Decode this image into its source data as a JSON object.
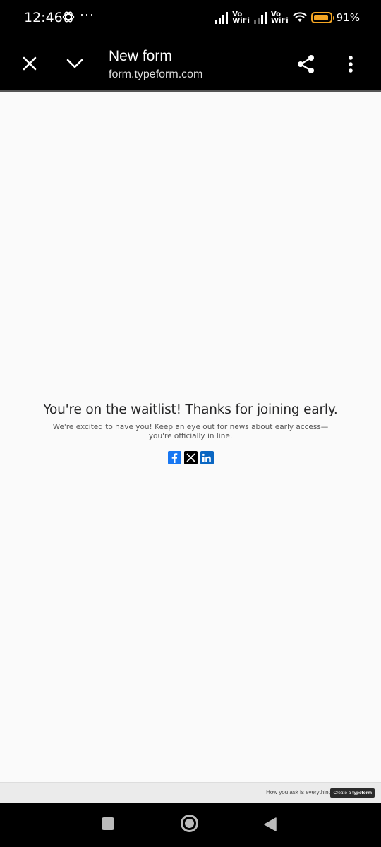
{
  "status_bar": {
    "time": "12:46",
    "dots": "···",
    "vowifi_1": "Vo\nWiFi",
    "vowifi_2": "Vo\nWiFi",
    "battery_percent": "91%",
    "battery_level": 0.91
  },
  "app_bar": {
    "title": "New form",
    "url": "form.typeform.com"
  },
  "page": {
    "heading": "You're on the waitlist! Thanks for joining early.",
    "subtext": "We're excited to have you! Keep an eye out for news about early access—you're officially in line.",
    "social": [
      {
        "name": "facebook-icon",
        "color": "#1877f2"
      },
      {
        "name": "x-icon",
        "color": "#000000"
      },
      {
        "name": "linkedin-icon",
        "color": "#0a66c2"
      }
    ]
  },
  "footer": {
    "tagline": "How you ask is everything",
    "cta_prefix": "Create a ",
    "cta_brand": "typeform"
  }
}
